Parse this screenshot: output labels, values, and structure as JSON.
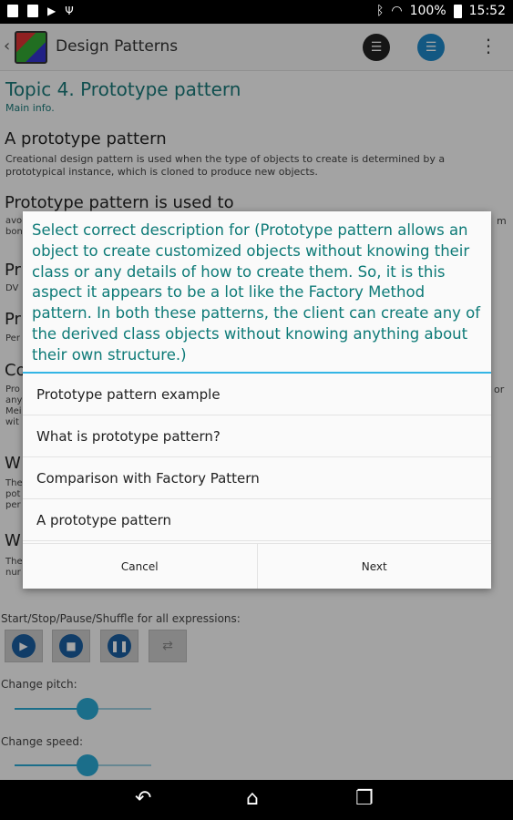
{
  "status_bar": {
    "battery": "100%",
    "time": "15:52"
  },
  "action_bar": {
    "title": "Design Patterns"
  },
  "content": {
    "topic_title": "Topic 4. Prototype pattern",
    "main_info": "Main info.",
    "section1_heading": "A prototype pattern",
    "section1_text": "Creational design pattern is used when the type of objects to create is determined by a prototypical instance, which is cloned to produce new objects.",
    "section2_heading": "Prototype pattern is used to",
    "frags": {
      "l1": "avo",
      "l2": "bon",
      "pr1": "Pr",
      "dv": "DV",
      "pr2": "Pr",
      "per": "Per",
      "co": "Co",
      "pro": "Pro",
      "any": "any",
      "mei": "Mei",
      "wit": "wit",
      "w1": "W",
      "the1": "The",
      "pot": "pot",
      "per2": "per",
      "w2": "W",
      "the2": "The",
      "nur": "nur",
      "or": "or",
      "m": "m"
    },
    "controls_label": "Start/Stop/Pause/Shuffle for all expressions:",
    "pitch_label": "Change pitch:",
    "speed_label": "Change speed:",
    "pitch_value": 0.53,
    "speed_value": 0.53
  },
  "dialog": {
    "title": "Select correct description for (Prototype pattern allows an object to create customized objects without knowing their class or any details of how to create them. So, it is this aspect it appears to be a lot like the Factory Method pattern. In both these patterns, the client can create any of the derived class objects without knowing anything about their own structure.)",
    "options": [
      "Prototype pattern example",
      "What is prototype pattern?",
      "Comparison with Factory Pattern",
      "A prototype pattern"
    ],
    "cancel_label": "Cancel",
    "next_label": "Next"
  }
}
